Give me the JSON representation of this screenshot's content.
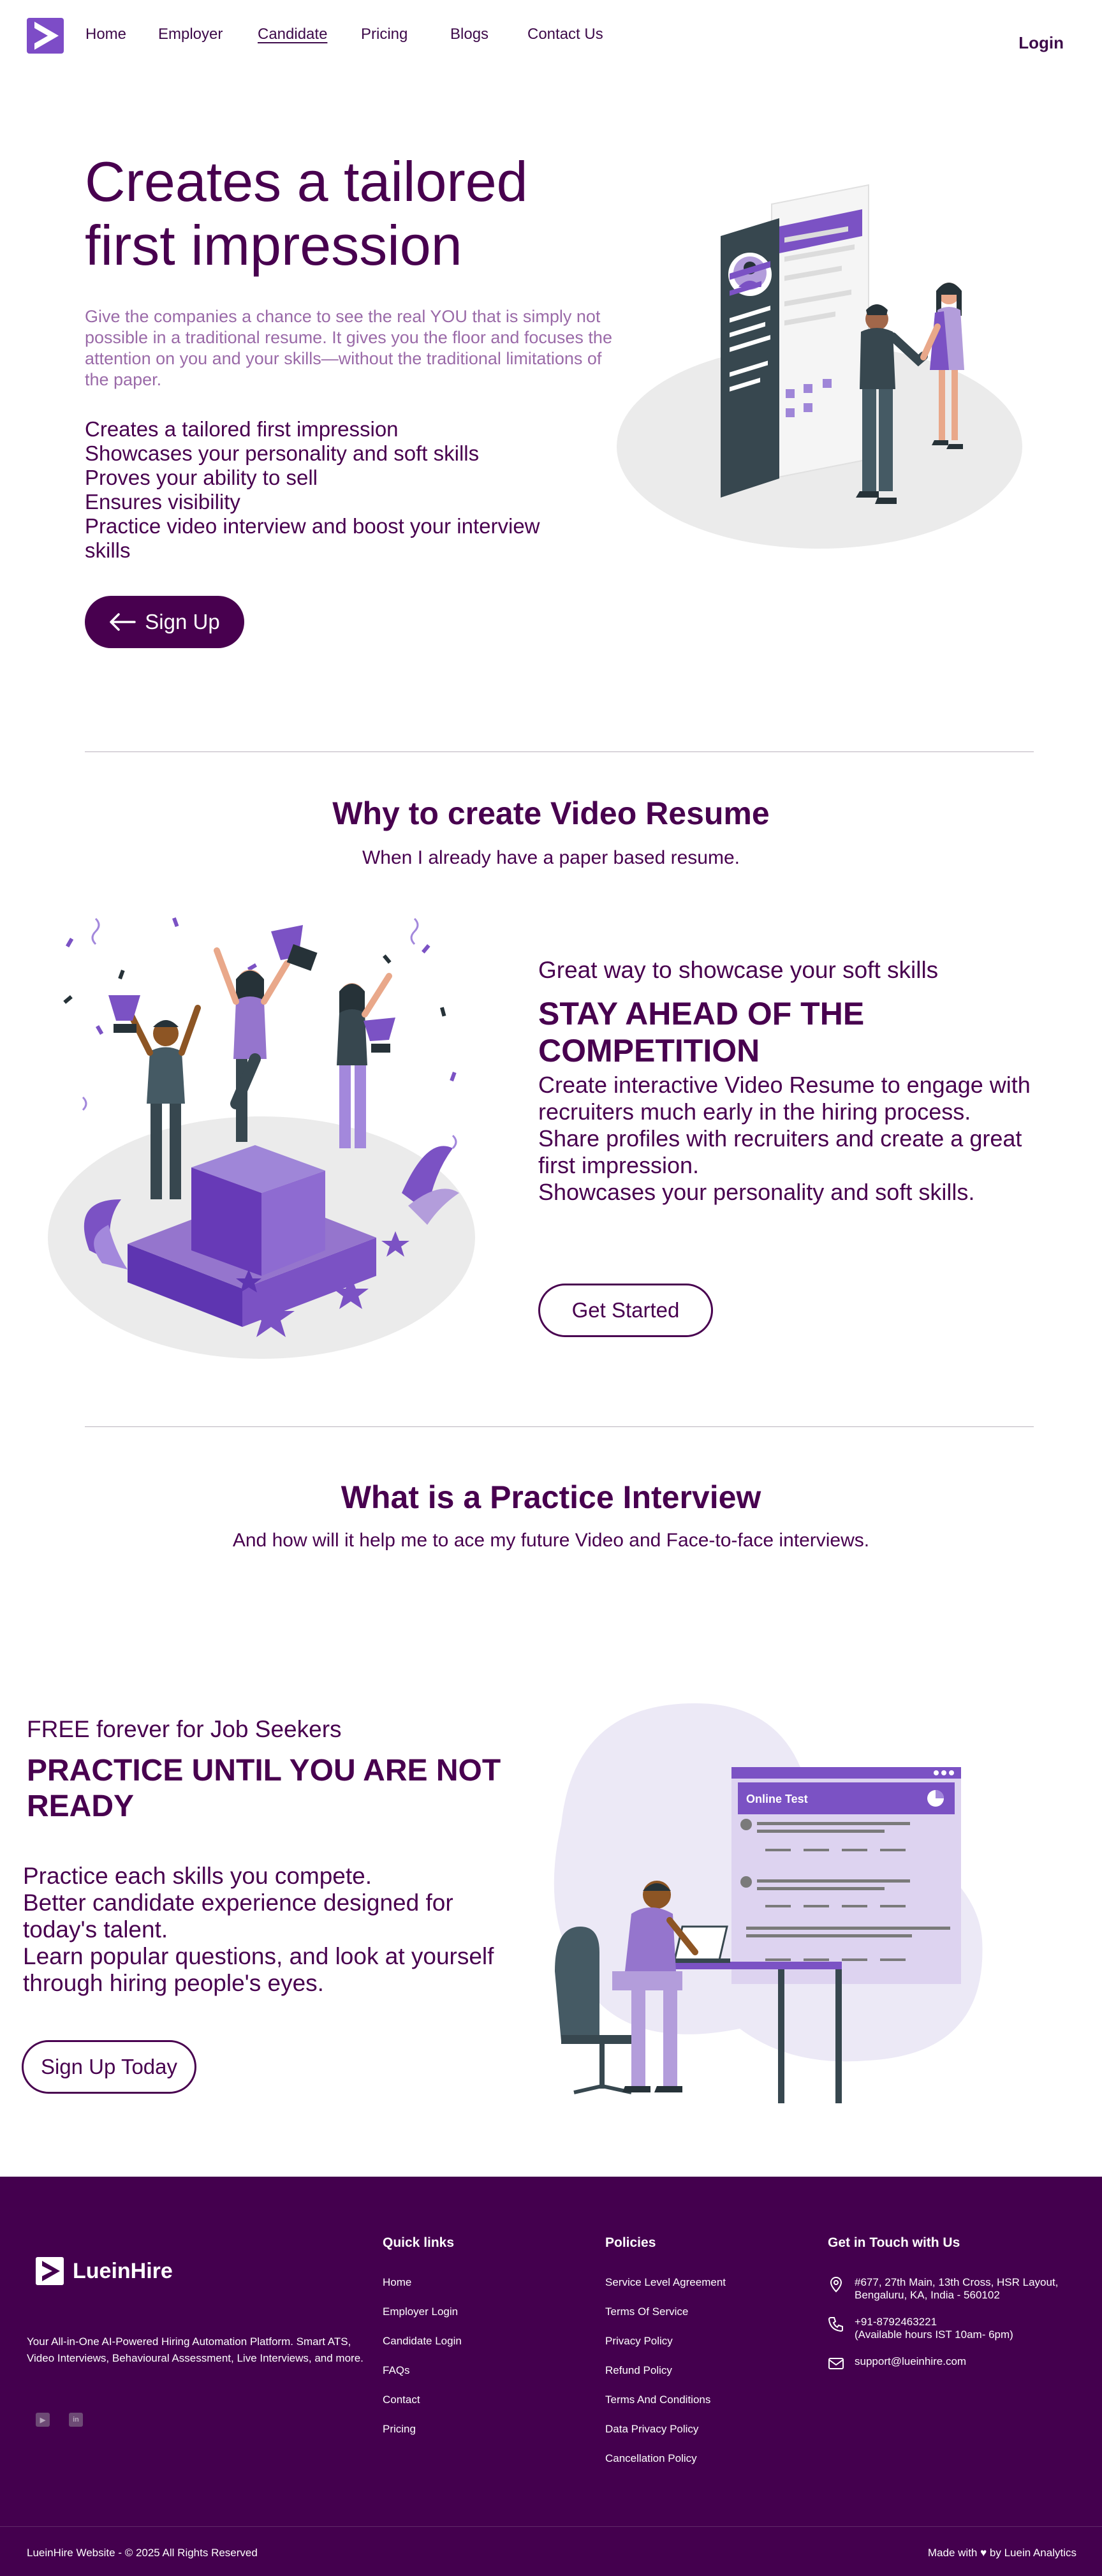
{
  "nav": {
    "links": [
      "Home",
      "Employer",
      "Candidate",
      "Pricing",
      "Blogs",
      "Contact Us"
    ],
    "active": "Candidate",
    "login": "Login"
  },
  "hero": {
    "title": "Creates a tailored first impression",
    "description": "Give the companies a chance to see the real YOU that is simply not possible in a traditional resume. It gives you the floor and focuses the attention on you and your skills—without the traditional limitations of the paper.",
    "points": [
      "Creates a tailored first impression",
      "Showcases your personality and soft skills",
      "Proves your ability to sell",
      "Ensures visibility",
      "Practice video interview and boost your interview skills"
    ],
    "cta": "Sign Up"
  },
  "why": {
    "title": "Why to create Video Resume",
    "subtitle": "When I already have a paper based resume.",
    "kicker": "Great way to showcase your soft skills",
    "heading": "STAY AHEAD OF THE COMPETITION",
    "points": [
      "Create interactive Video Resume to engage with recruiters much early in the hiring process.",
      "Share profiles with recruiters and create a great first impression.",
      "Showcases your personality and soft skills."
    ],
    "cta": "Get Started"
  },
  "practice_intro": {
    "title": "What is a Practice Interview",
    "subtitle": "And how will it help me to ace my future Video and Face-to-face interviews."
  },
  "practice": {
    "kicker": "FREE forever for Job Seekers",
    "heading": "PRACTICE UNTIL YOU ARE NOT READY",
    "points": [
      "Practice each skills you compete.",
      "Better candidate experience designed for today's talent.",
      "Learn popular questions, and look at yourself through hiring people's eyes."
    ],
    "cta": "Sign Up Today",
    "screen_title": "Online Test"
  },
  "footer": {
    "brand": "LueinHire",
    "tagline": "Your All-in-One AI-Powered Hiring Automation Platform. Smart ATS, Video Interviews, Behavioural Assessment, Live Interviews, and more.",
    "quick_links": {
      "title": "Quick links",
      "items": [
        "Home",
        "Employer Login",
        "Candidate Login",
        "FAQs",
        "Contact",
        "Pricing"
      ]
    },
    "policies": {
      "title": "Policies",
      "items": [
        "Service Level Agreement",
        "Terms Of Service",
        "Privacy Policy",
        "Refund Policy",
        "Terms And Conditions",
        "Data Privacy Policy",
        "Cancellation Policy"
      ]
    },
    "contact": {
      "title": "Get in Touch with Us",
      "address": "#677, 27th Main, 13th Cross, HSR Layout,\nBengaluru, KA, India - 560102",
      "phone": "+91-8792463221\n(Available hours IST 10am- 6pm)",
      "email": "support@lueinhire.com"
    },
    "copyright": "LueinHire Website - © 2025 All Rights Reserved",
    "made_with": "Made with ♥ by Luein Analytics"
  },
  "colors": {
    "deep_purple": "#48004f",
    "accent_purple": "#7b52c4",
    "light_purple": "#a388dc",
    "footer_bg": "#44004e"
  },
  "icons": [
    "play-logo-icon",
    "arrow-left-icon",
    "youtube-icon",
    "linkedin-icon",
    "location-icon",
    "phone-icon",
    "mail-icon"
  ]
}
